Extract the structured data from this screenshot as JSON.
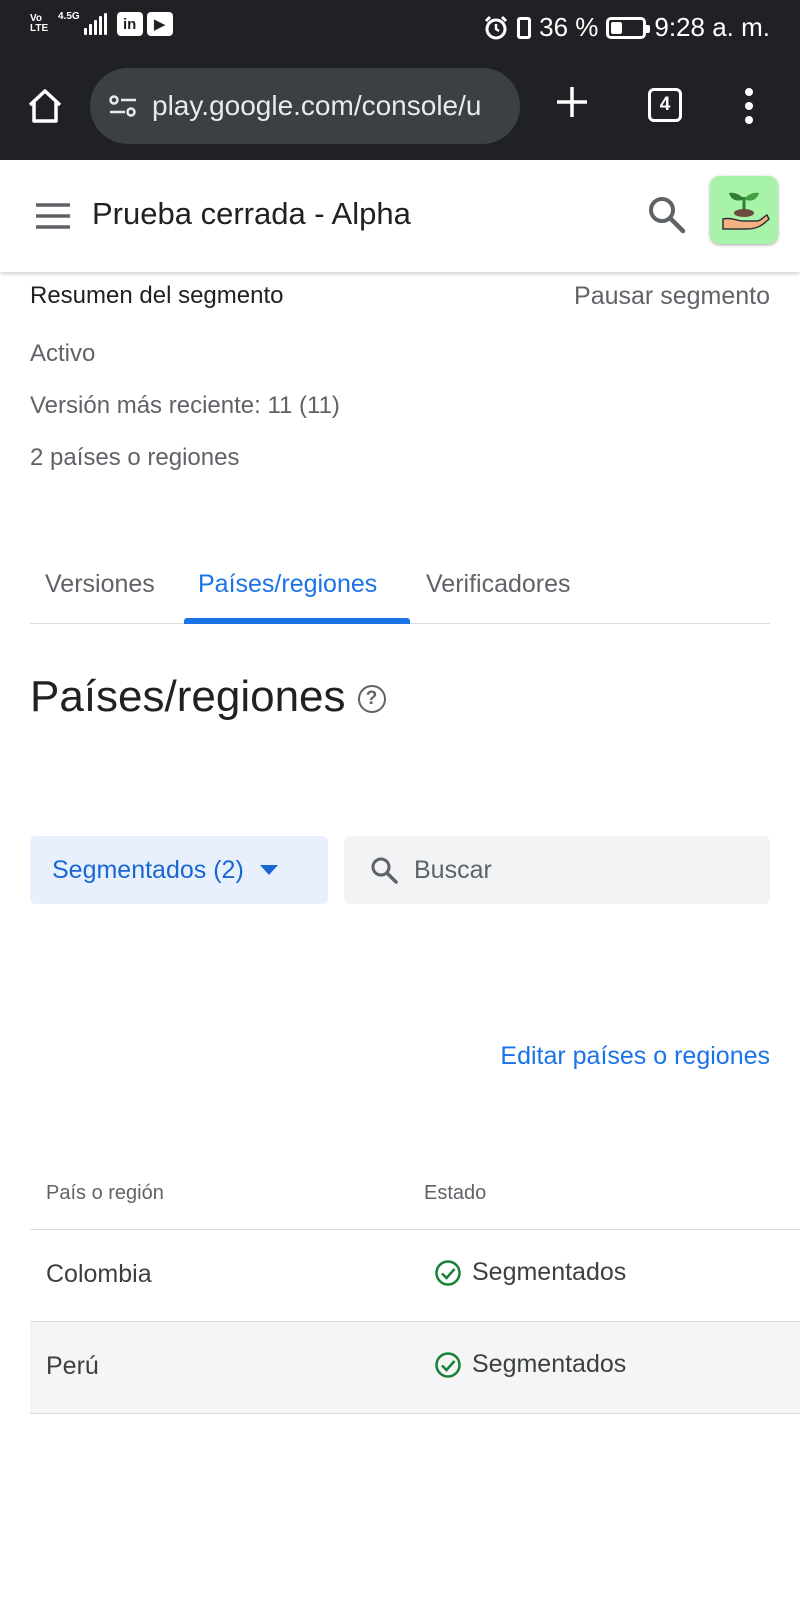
{
  "status_bar": {
    "network_label": "VoLTE",
    "signal_label": "4.5G",
    "battery": "36 %",
    "battery_level_pct": 36,
    "time": "9:28 a. m."
  },
  "browser": {
    "url": "play.google.com/console/u",
    "tab_count": "4"
  },
  "header": {
    "title": "Prueba cerrada - Alpha"
  },
  "summary": {
    "title": "Resumen del segmento",
    "pause_label": "Pausar segmento",
    "status": "Activo",
    "latest_version": "Versión más reciente: 11 (11)",
    "countries": "2 países o regiones"
  },
  "tabs": [
    {
      "label": "Versiones"
    },
    {
      "label": "Países/regiones"
    },
    {
      "label": "Verificadores"
    }
  ],
  "section": {
    "title": "Países/regiones",
    "help_glyph": "?"
  },
  "filter": {
    "label": "Segmentados (2)"
  },
  "search": {
    "placeholder": "Buscar"
  },
  "edit_link": "Editar países o regiones",
  "table": {
    "columns": [
      "País o región",
      "Estado"
    ],
    "rows": [
      {
        "country": "Colombia",
        "status": "Segmentados"
      },
      {
        "country": "Perú",
        "status": "Segmentados"
      }
    ]
  },
  "colors": {
    "accent": "#1a73e8",
    "success": "#188038",
    "chrome_dark": "#202124",
    "app_icon_bg": "#a7f3a9"
  }
}
